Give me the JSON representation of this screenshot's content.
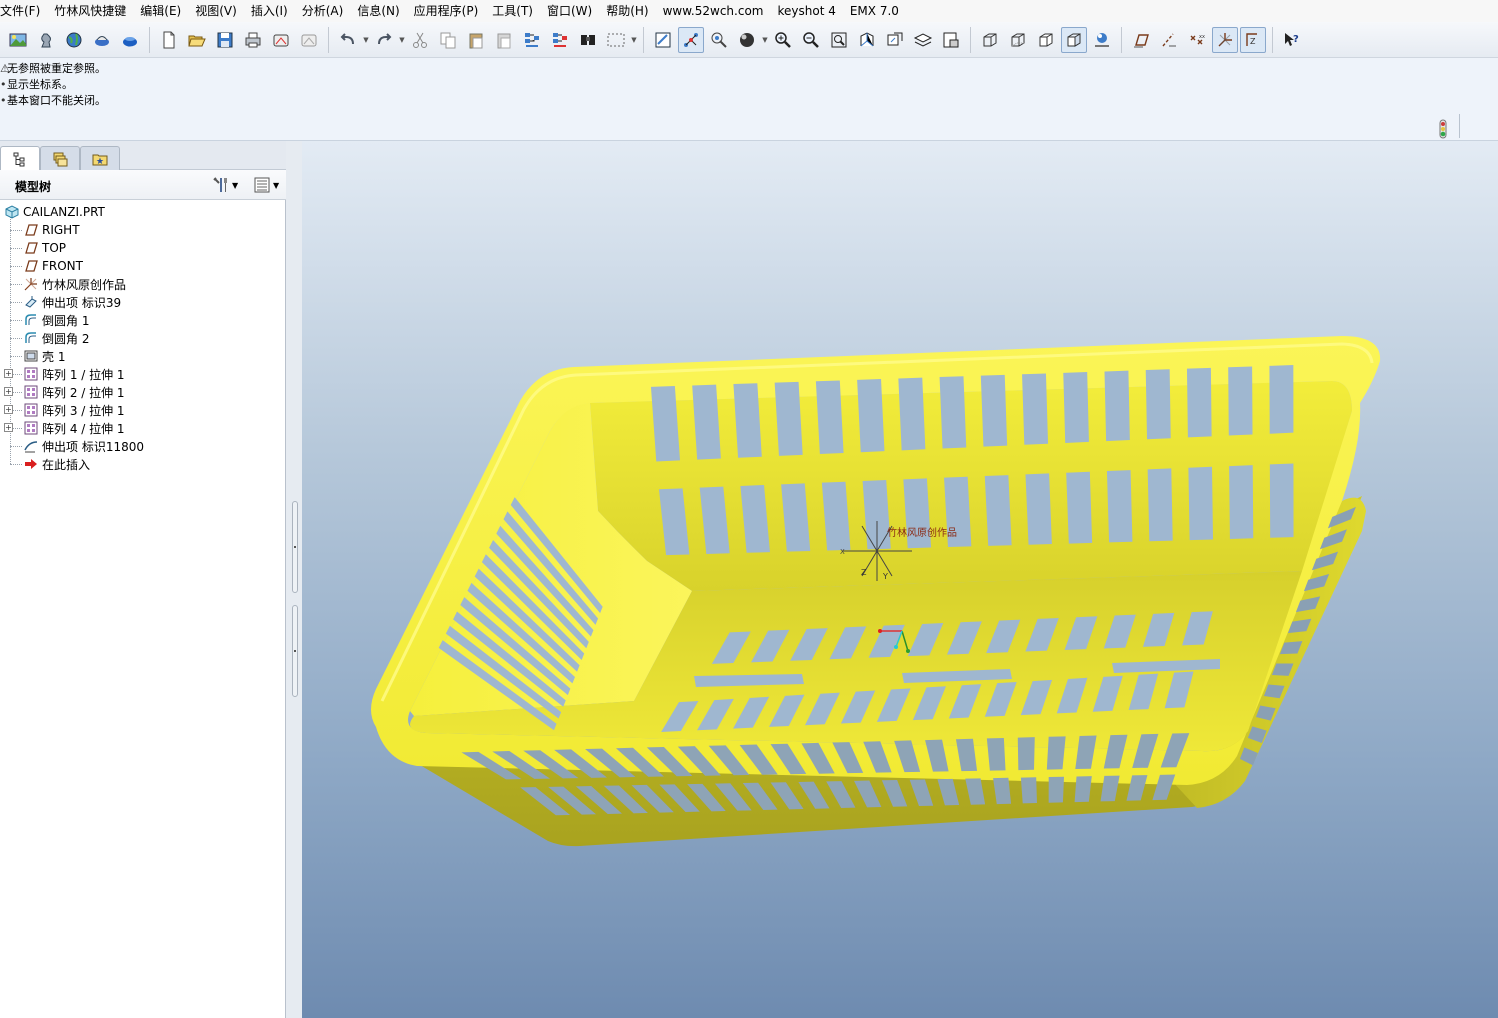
{
  "menubar": {
    "items": [
      "文件(F)",
      "竹林风快捷键",
      "编辑(E)",
      "视图(V)",
      "插入(I)",
      "分析(A)",
      "信息(N)",
      "应用程序(P)",
      "工具(T)",
      "窗口(W)",
      "帮助(H)",
      "www.52wch.com",
      "keyshot 4",
      "EMX 7.0"
    ]
  },
  "toolbar": {
    "groups": [
      [
        "image-icon",
        "chess-icon",
        "globe-icon",
        "kettle-icon",
        "blue-kettle-icon"
      ],
      [
        "new-file-icon",
        "open-folder-icon",
        "save-icon",
        "print-icon",
        "mail-icon",
        "mail-disabled-icon"
      ],
      [
        "undo-icon",
        "redo-icon",
        "cut-icon",
        "copy-icon",
        "paste-icon",
        "paste-special-icon",
        "regenerate-icon",
        "regenerate-manager-icon",
        "find-icon",
        "select-box-icon"
      ],
      [
        "repaint-icon",
        "spin-center-icon",
        "orient-mode-icon",
        "appearance-icon",
        "zoom-in-icon",
        "zoom-out-icon",
        "refit-icon",
        "reorient-icon",
        "saved-views-icon",
        "layers-icon",
        "view-manager-icon"
      ],
      [
        "wireframe-icon",
        "hidden-line-icon",
        "no-hidden-icon",
        "shading-icon",
        "enhanced-realism-icon"
      ],
      [
        "datum-planes-icon",
        "datum-axes-icon",
        "datum-points-icon",
        "coordinate-systems-icon",
        "annotations-icon"
      ],
      [
        "context-help-icon"
      ]
    ]
  },
  "messages": [
    {
      "mark": "⚠",
      "text": "无参照被重定参照。"
    },
    {
      "mark": "•",
      "text": "显示坐标系。"
    },
    {
      "mark": "•",
      "text": "基本窗口不能关闭。"
    }
  ],
  "tree": {
    "title": "模型树",
    "root": "CAILANZI.PRT",
    "items": [
      {
        "label": "RIGHT",
        "icon": "datum-plane-icon",
        "expandable": false
      },
      {
        "label": "TOP",
        "icon": "datum-plane-icon",
        "expandable": false
      },
      {
        "label": "FRONT",
        "icon": "datum-plane-icon",
        "expandable": false
      },
      {
        "label": "竹林风原创作品",
        "icon": "coordinate-system-icon",
        "expandable": false
      },
      {
        "label": "伸出项 标识39",
        "icon": "extrude-icon",
        "expandable": false
      },
      {
        "label": "倒圆角 1",
        "icon": "round-icon",
        "expandable": false
      },
      {
        "label": "倒圆角 2",
        "icon": "round-icon",
        "expandable": false
      },
      {
        "label": "壳 1",
        "icon": "shell-icon",
        "expandable": false
      },
      {
        "label": "阵列 1 / 拉伸 1",
        "icon": "pattern-icon",
        "expandable": true
      },
      {
        "label": "阵列 2 / 拉伸 1",
        "icon": "pattern-icon",
        "expandable": true
      },
      {
        "label": "阵列 3 / 拉伸 1",
        "icon": "pattern-icon",
        "expandable": true
      },
      {
        "label": "阵列 4 / 拉伸 1",
        "icon": "pattern-icon",
        "expandable": true
      },
      {
        "label": "伸出项 标识11800",
        "icon": "protrusion-icon",
        "expandable": false
      },
      {
        "label": "在此插入",
        "icon": "insert-here-arrow-icon",
        "expandable": false
      }
    ]
  },
  "viewport": {
    "csys_label": "竹林风原创作品",
    "axis_labels": {
      "x": "X",
      "y": "Y",
      "z": "Z"
    },
    "colors": {
      "basket": "#f5ef3c",
      "basket_shade": "#c9c322",
      "basket_dark": "#a29e1f",
      "hole": "#9fb7d0",
      "background_top": "#e3ebf4",
      "background_bottom": "#6e8bb0"
    }
  }
}
